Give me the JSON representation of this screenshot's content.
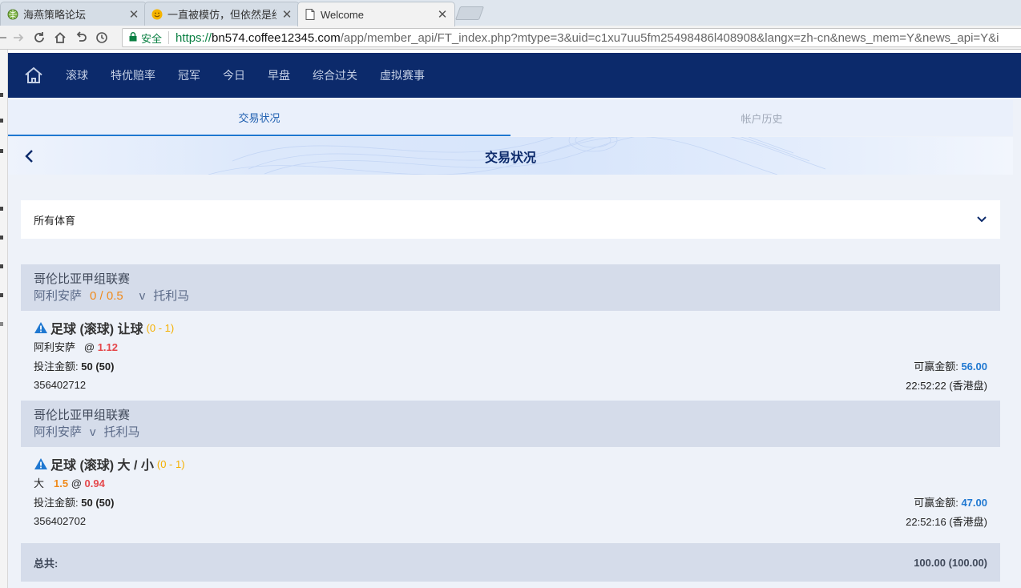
{
  "browser": {
    "tabs": [
      {
        "title": "海燕策略论坛",
        "icon": "globe-icon",
        "active": false
      },
      {
        "title": "一直被模仿，但依然是经",
        "icon": "smile-icon",
        "active": false
      },
      {
        "title": "Welcome",
        "icon": "page-icon",
        "active": true
      }
    ],
    "close_glyph": "✕",
    "secure_label": "安全",
    "url_scheme": "https://",
    "url_host": "bn574.coffee12345.com",
    "url_rest": "/app/member_api/FT_index.php?mtype=3&uid=c1xu7uu5fm25498486l408908&langx=zh-cn&news_mem=Y&news_api=Y&i"
  },
  "nav": {
    "items": [
      "滚球",
      "特优赔率",
      "冠军",
      "今日",
      "早盘",
      "综合过关",
      "虚拟赛事"
    ]
  },
  "subtabs": {
    "active": "交易状况",
    "inactive": "帐户历史"
  },
  "page": {
    "title": "交易状况"
  },
  "filter": {
    "value": "所有体育"
  },
  "bets": [
    {
      "league": "哥伦比亚甲组联赛",
      "home": "阿利安萨",
      "handicap": "0 / 0.5",
      "vs": "v",
      "away": "托利马",
      "title": "足球 (滚球) 让球",
      "score": "(0 - 1)",
      "selection": "阿利安萨",
      "point": "",
      "at": "@",
      "odds": "1.12",
      "stake_label": "投注金额:",
      "stake": "50 (50)",
      "win_label": "可赢金额:",
      "win": "56.00",
      "ticket": "356402712",
      "time": "22:52:22 (香港盘)"
    },
    {
      "league": "哥伦比亚甲组联赛",
      "home": "阿利安萨",
      "handicap": "",
      "vs": "v",
      "away": "托利马",
      "title": "足球 (滚球) 大 / 小",
      "score": "(0 - 1)",
      "selection": "大",
      "point": "1.5",
      "at": "@",
      "odds": "0.94",
      "stake_label": "投注金额:",
      "stake": "50 (50)",
      "win_label": "可赢金额:",
      "win": "47.00",
      "ticket": "356402702",
      "time": "22:52:16 (香港盘)"
    }
  ],
  "total": {
    "label": "总共:",
    "value": "100.00 (100.00)"
  },
  "colors": {
    "nav_bg": "#0c2a6b",
    "accent": "#1f78d1",
    "odds": "#e5474b",
    "handicap": "#f08a1b",
    "score": "#f5b000"
  }
}
